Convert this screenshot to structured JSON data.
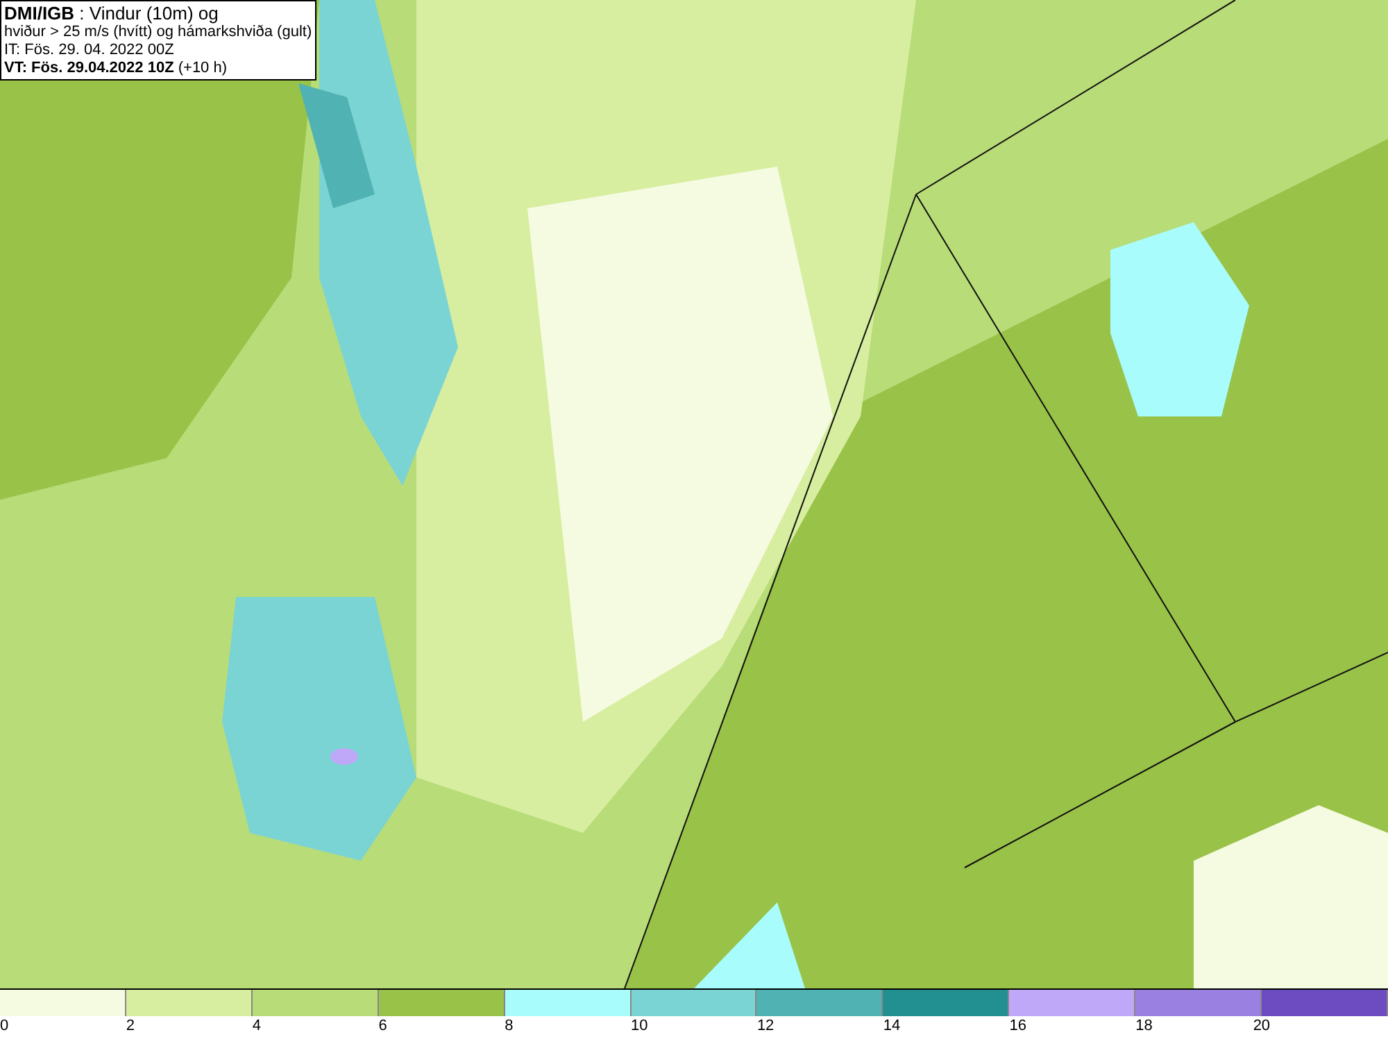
{
  "header": {
    "lines": [
      "**DMI/IGB** : Vindur (10m) og",
      "hviður > 25 m/s (hvítt) og hámarkshviða (gult)",
      "IT: Fös. 29. 04. 2022 00Z",
      "**VT: Fös. 29.04.2022 10Z** (+10 h)"
    ]
  },
  "legend": [
    {
      "color": "#f5fbe0",
      "label": "0"
    },
    {
      "color": "#d7eea0",
      "label": "2"
    },
    {
      "color": "#b8dc78",
      "label": "4"
    },
    {
      "color": "#99c248",
      "label": "6"
    },
    {
      "color": "#a8fcfc",
      "label": "8"
    },
    {
      "color": "#7ad4d4",
      "label": "10"
    },
    {
      "color": "#50b2b2",
      "label": "12"
    },
    {
      "color": "#229090",
      "label": "14"
    },
    {
      "color": "#c0a8f8",
      "label": "16"
    },
    {
      "color": "#9a80e0",
      "label": "18"
    },
    {
      "color": "#6c4cc0"
    }
  ],
  "legend_last_label": "20"
}
